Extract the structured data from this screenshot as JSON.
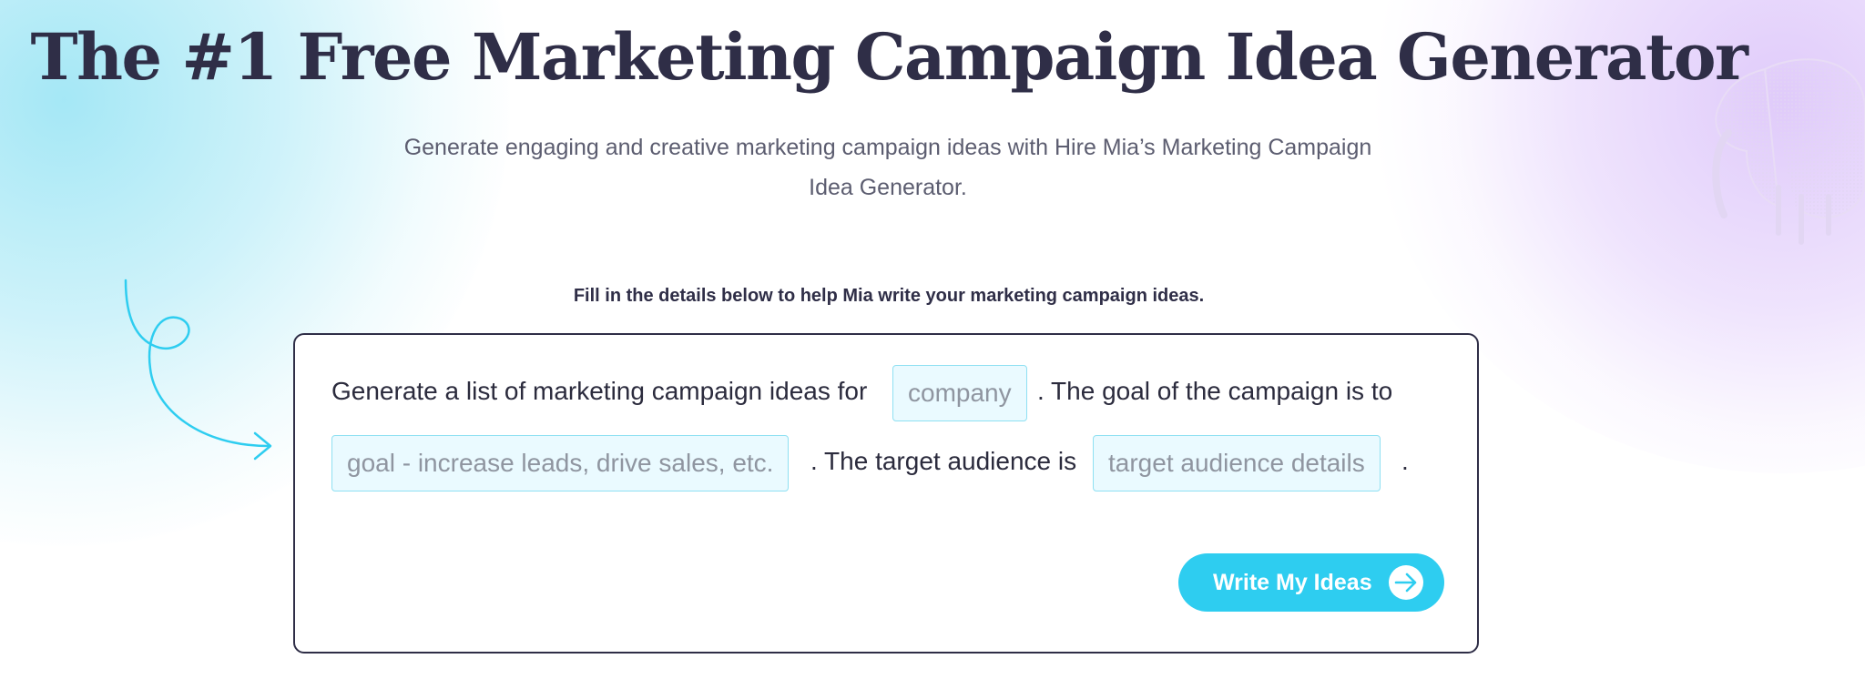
{
  "hero": {
    "title": "The #1 Free Marketing Campaign Idea Generator",
    "subtitle_line1": "Generate engaging and creative marketing campaign ideas with Hire Mia’s Marketing Campaign",
    "subtitle_line2": "Idea Generator.",
    "mascot_icon": "elephant-mascot-icon"
  },
  "form": {
    "instruction": "Fill in the details below to help Mia write your marketing campaign ideas.",
    "text_part1": "Generate a list of marketing campaign ideas for",
    "company_placeholder": "company",
    "text_part2": ". The goal of the campaign is to",
    "goal_placeholder": "goal - increase leads, drive sales, etc.",
    "text_part3": ". The target audience is",
    "audience_placeholder": "target audience details",
    "text_part4": ".",
    "submit_label": "Write My Ideas",
    "submit_icon": "arrow-right-circle-icon"
  },
  "colors": {
    "heading": "#2f2e47",
    "accent": "#2ecdf0",
    "field_background": "#eafaff",
    "field_border": "#8fe0f2"
  }
}
